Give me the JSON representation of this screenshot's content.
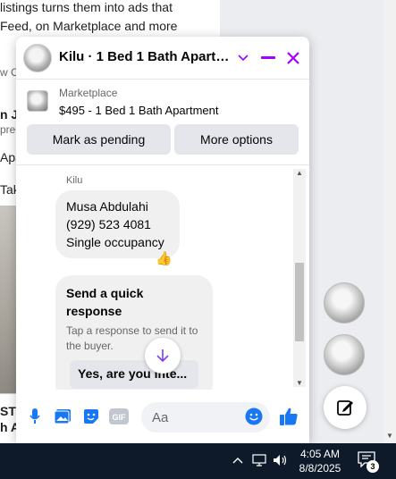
{
  "background_page": {
    "lines": [
      "listings turns them into ads that",
      "Feed, on Marketplace and more",
      "w C",
      "n J",
      "pred",
      "Apa",
      "Take",
      "STI",
      "h A"
    ]
  },
  "chat": {
    "title": "Kilu · 1 Bed 1 Bath Apartm...",
    "icons": [
      "chevron-down-icon",
      "minimize-icon",
      "close-icon"
    ],
    "listing": {
      "source": "Marketplace",
      "title": "$495 - 1 Bed 1 Bath Apartment",
      "mark_pending": "Mark as pending",
      "more_options": "More options"
    },
    "messages": {
      "sender": "Kilu",
      "bubble_lines": [
        "Musa Abdulahi",
        "(929) 523 4081",
        "Single occupancy"
      ],
      "reaction": "👍"
    },
    "quick_response": {
      "title": "Send a quick response",
      "subtitle": "Tap a response to send it to the buyer.",
      "option": "Yes, are you inte..."
    },
    "composer": {
      "placeholder": "Aa",
      "icons": [
        "microphone-icon",
        "photo-icon",
        "sticker-icon",
        "gif-icon",
        "emoji-icon",
        "thumbs-up-icon"
      ],
      "gif_label": "GIF"
    }
  },
  "taskbar": {
    "time": "4:05 AM",
    "date": "8/8/2025",
    "notification_count": "3"
  },
  "colors": {
    "accent": "#a100ff",
    "messenger_blue": "#1877f2",
    "taskbar": "#0e1a2a"
  }
}
